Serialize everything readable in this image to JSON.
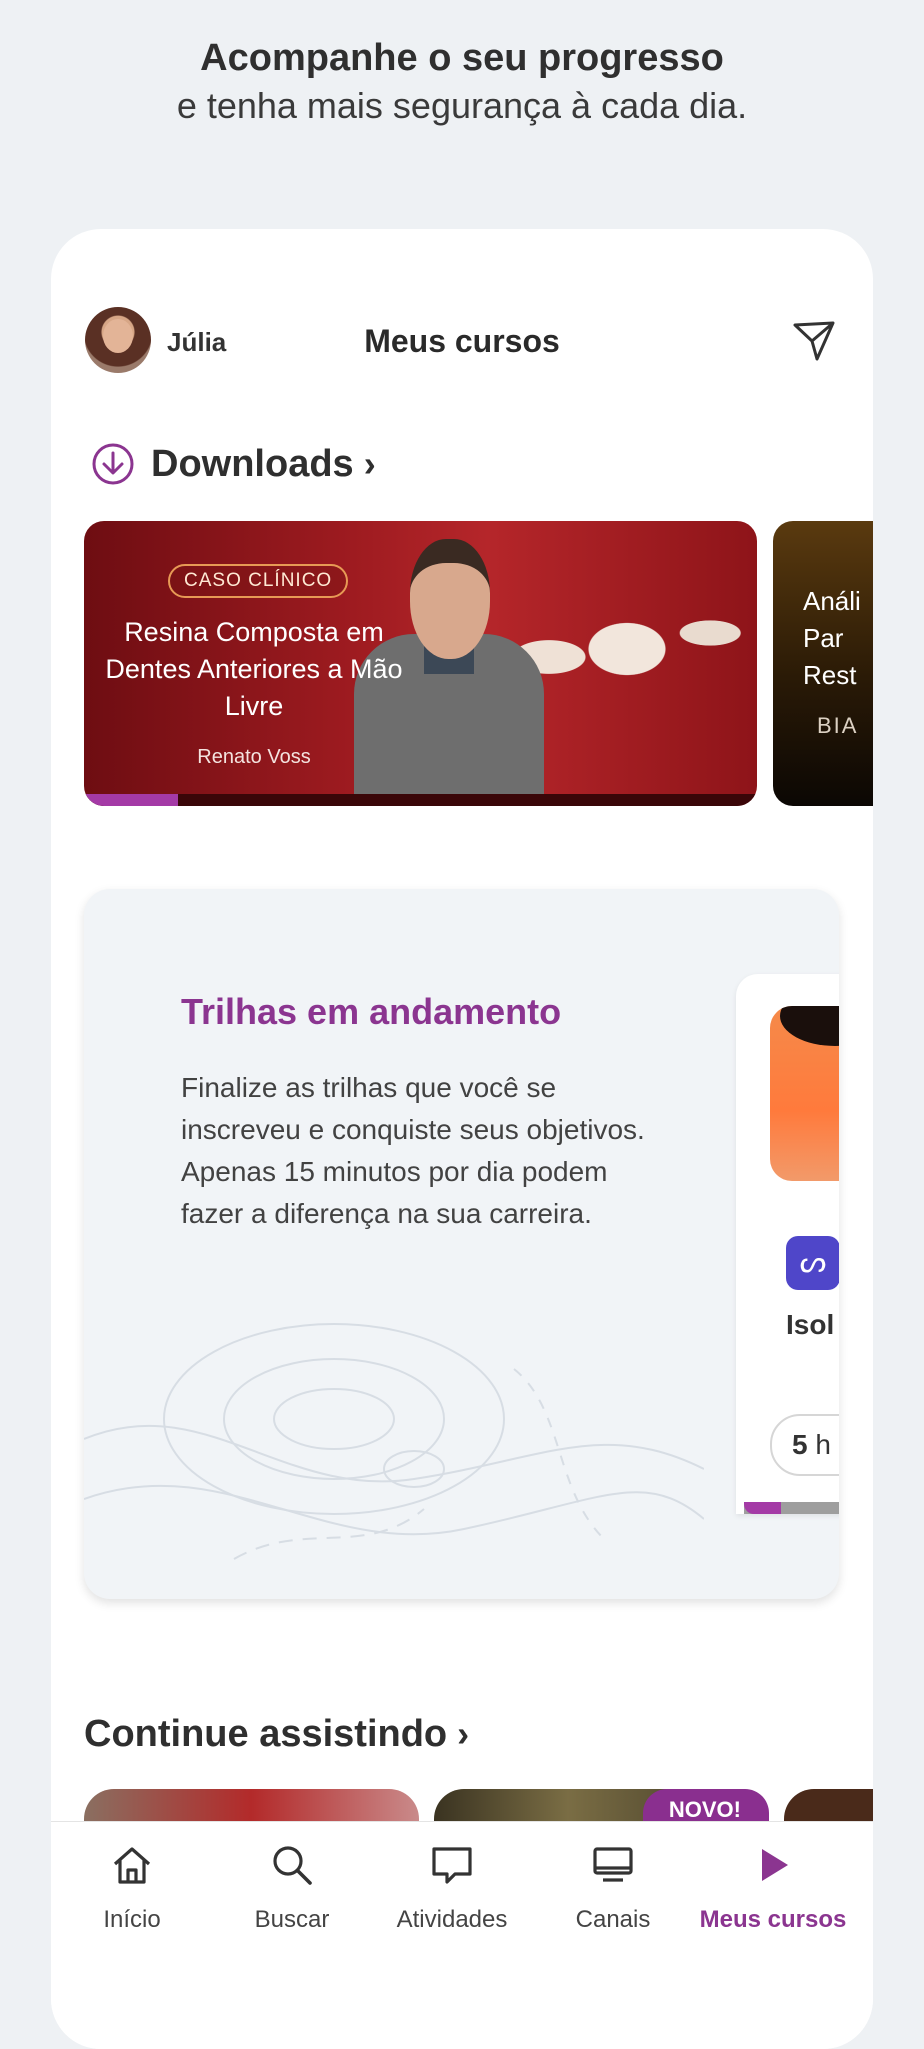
{
  "header": {
    "title_bold": "Acompanhe o seu progresso",
    "title_light": "e tenha mais segurança à cada dia."
  },
  "topbar": {
    "user_name": "Júlia",
    "page_title": "Meus cursos",
    "icons": {
      "avatar": "user-avatar",
      "send": "send-icon"
    }
  },
  "downloads": {
    "label": "Downloads",
    "chevron": "›",
    "icon": "download-circle-icon",
    "cards": [
      {
        "badge": "CASO CLÍNICO",
        "title": "Resina Composta em Dentes Anteriores a Mão Livre",
        "author": "Renato Voss",
        "progress": 0.14
      },
      {
        "title": "Análi\nPar\nRest",
        "author": "BIA"
      }
    ]
  },
  "trilhas": {
    "title": "Trilhas em andamento",
    "description": "Finalize as trilhas que você se inscreveu e conquiste seus objetivos. Apenas 15 minutos por dia podem fazer a diferença na sua carreira.",
    "card": {
      "logo_glyph": "ᔕ",
      "name": "Isol",
      "duration_bold": "5",
      "duration_rest": "h",
      "progress": 0.28
    }
  },
  "continue": {
    "label": "Continue assistindo",
    "chevron": "›",
    "novo_badge": "NOVO!"
  },
  "tabbar": {
    "items": [
      {
        "label": "Início",
        "icon": "home-icon",
        "active": false
      },
      {
        "label": "Buscar",
        "icon": "search-icon",
        "active": false
      },
      {
        "label": "Atividades",
        "icon": "chat-icon",
        "active": false
      },
      {
        "label": "Canais",
        "icon": "monitor-icon",
        "active": false
      },
      {
        "label": "Meus cursos",
        "icon": "play-icon",
        "active": true
      }
    ]
  },
  "colors": {
    "accent": "#8b3590",
    "progress": "#a43aa6",
    "background": "#eef1f4"
  }
}
